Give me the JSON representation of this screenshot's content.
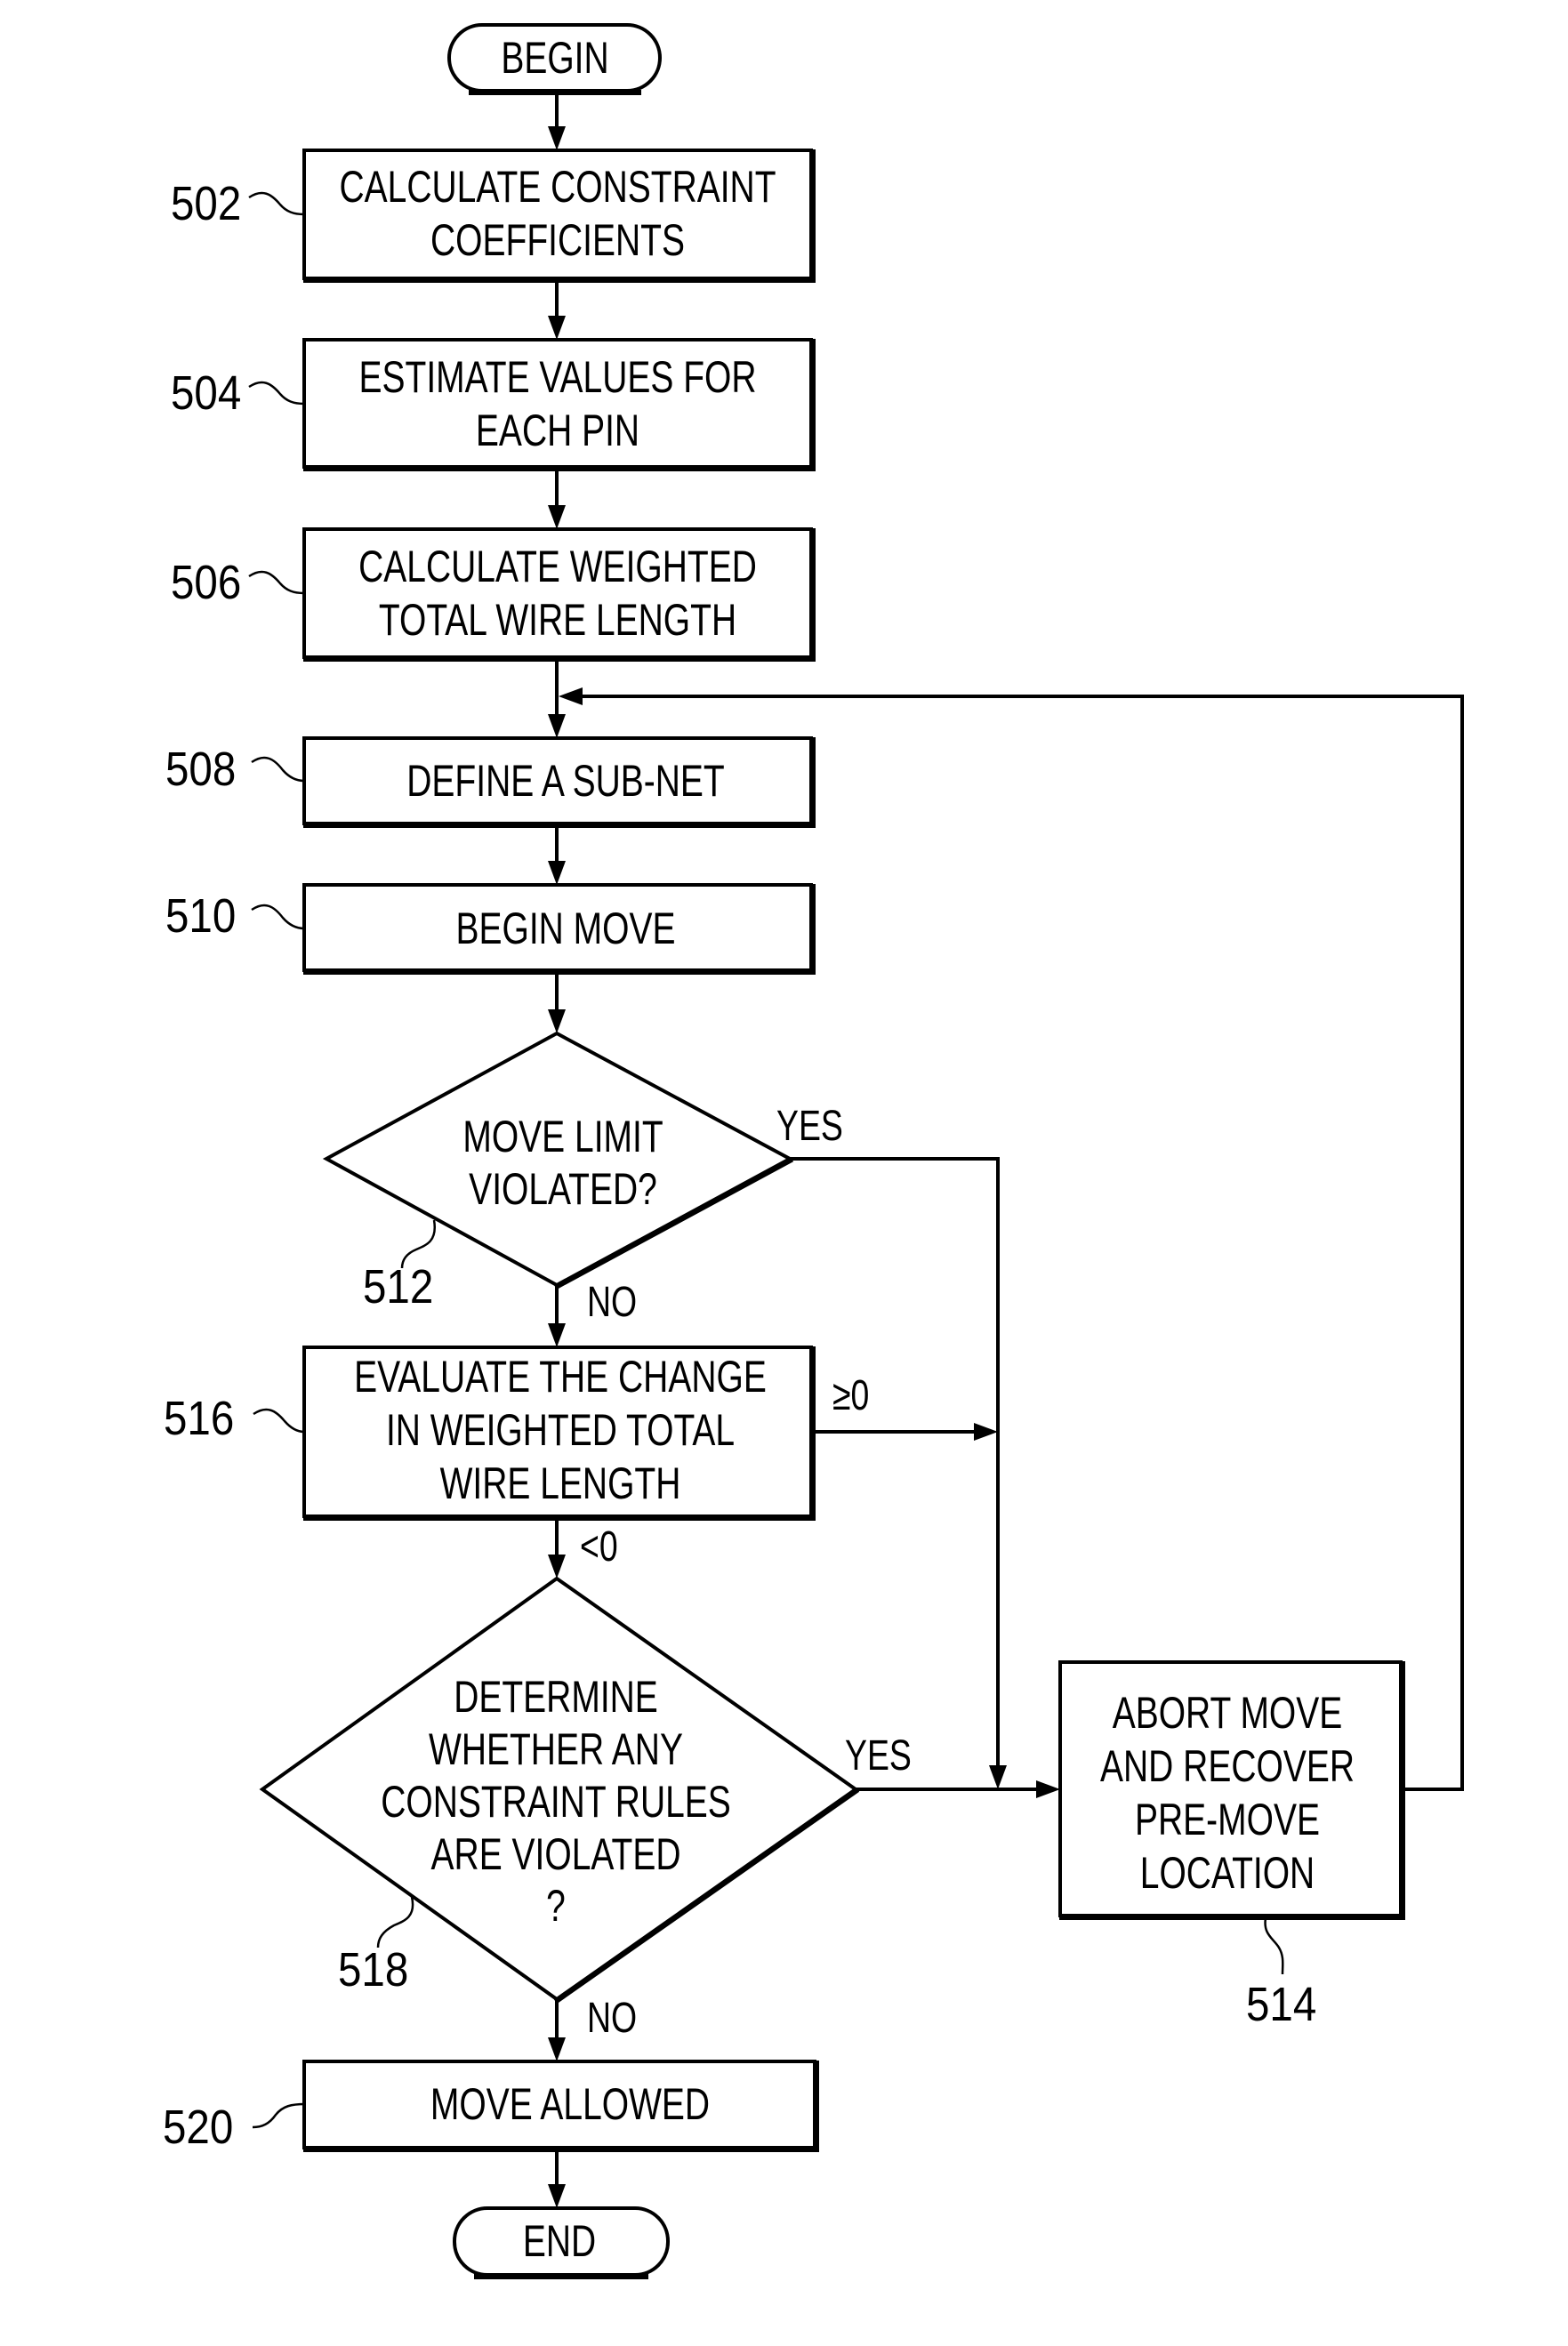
{
  "figure": {
    "terminals": {
      "begin": "BEGIN",
      "end": "END"
    },
    "nodes": {
      "n502": {
        "ref": "502",
        "type": "process",
        "lines": [
          "CALCULATE CONSTRAINT",
          "COEFFICIENTS"
        ]
      },
      "n504": {
        "ref": "504",
        "type": "process",
        "lines": [
          "ESTIMATE VALUES FOR",
          "EACH PIN"
        ]
      },
      "n506": {
        "ref": "506",
        "type": "process",
        "lines": [
          "CALCULATE WEIGHTED",
          "TOTAL WIRE LENGTH"
        ]
      },
      "n508": {
        "ref": "508",
        "type": "process",
        "lines": [
          "DEFINE A SUB-NET"
        ]
      },
      "n510": {
        "ref": "510",
        "type": "process",
        "lines": [
          "BEGIN MOVE"
        ]
      },
      "n512": {
        "ref": "512",
        "type": "decision",
        "lines": [
          "MOVE LIMIT",
          "VIOLATED?"
        ]
      },
      "n514": {
        "ref": "514",
        "type": "process",
        "lines": [
          "ABORT MOVE",
          "AND RECOVER",
          "PRE-MOVE",
          "LOCATION"
        ]
      },
      "n516": {
        "ref": "516",
        "type": "process",
        "lines": [
          "EVALUATE THE CHANGE",
          "IN WEIGHTED TOTAL",
          "WIRE LENGTH"
        ]
      },
      "n518": {
        "ref": "518",
        "type": "decision",
        "lines": [
          "DETERMINE",
          "WHETHER ANY",
          "CONSTRAINT RULES",
          "ARE VIOLATED",
          "?"
        ]
      },
      "n520": {
        "ref": "520",
        "type": "process",
        "lines": [
          "MOVE ALLOWED"
        ]
      }
    },
    "edge_labels": {
      "n512_yes": "YES",
      "n512_no": "NO",
      "n516_gte_zero": "≥0",
      "n516_lt_zero": "<0",
      "n518_yes": "YES",
      "n518_no": "NO"
    },
    "edges": [
      {
        "from": "begin",
        "to": "n502"
      },
      {
        "from": "n502",
        "to": "n504"
      },
      {
        "from": "n504",
        "to": "n506"
      },
      {
        "from": "n506",
        "to": "n508"
      },
      {
        "from": "n508",
        "to": "n510"
      },
      {
        "from": "n510",
        "to": "n512"
      },
      {
        "from": "n512",
        "to": "n516",
        "label": "NO"
      },
      {
        "from": "n512",
        "to": "n514",
        "label": "YES"
      },
      {
        "from": "n516",
        "to": "n518",
        "label": "<0"
      },
      {
        "from": "n516",
        "to": "n514",
        "label": "≥0"
      },
      {
        "from": "n518",
        "to": "n514",
        "label": "YES"
      },
      {
        "from": "n518",
        "to": "n520",
        "label": "NO"
      },
      {
        "from": "n514",
        "to": "n508"
      },
      {
        "from": "n520",
        "to": "end"
      }
    ]
  }
}
